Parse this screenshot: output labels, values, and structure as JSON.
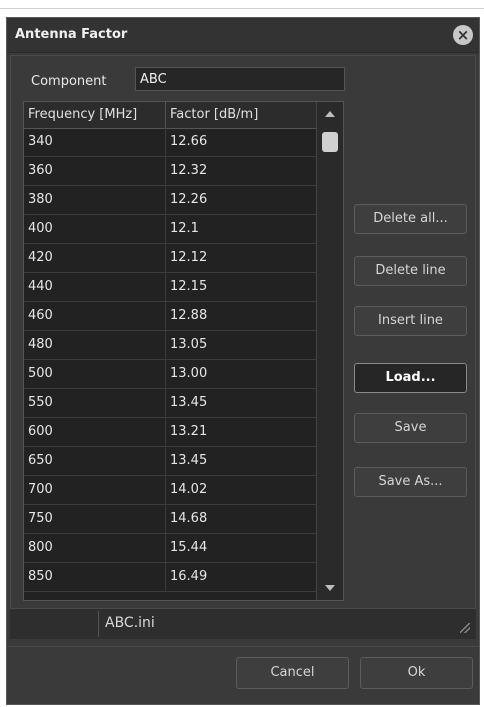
{
  "dialog": {
    "title": "Antenna Factor"
  },
  "component": {
    "label": "Component",
    "value": "ABC"
  },
  "table": {
    "headers": [
      "Frequency [MHz]",
      "Factor [dB/m]"
    ],
    "rows": [
      [
        "340",
        "12.66"
      ],
      [
        "360",
        "12.32"
      ],
      [
        "380",
        "12.26"
      ],
      [
        "400",
        "12.1"
      ],
      [
        "420",
        "12.12"
      ],
      [
        "440",
        "12.15"
      ],
      [
        "460",
        "12.88"
      ],
      [
        "480",
        "13.05"
      ],
      [
        "500",
        "13.00"
      ],
      [
        "550",
        "13.45"
      ],
      [
        "600",
        "13.21"
      ],
      [
        "650",
        "13.45"
      ],
      [
        "700",
        "14.02"
      ],
      [
        "750",
        "14.68"
      ],
      [
        "800",
        "15.44"
      ],
      [
        "850",
        "16.49"
      ]
    ]
  },
  "buttons": {
    "delete_all": "Delete all...",
    "delete_line": "Delete line",
    "insert_line": "Insert line",
    "load": "Load...",
    "save": "Save",
    "save_as": "Save As..."
  },
  "status": {
    "file": "ABC.ini"
  },
  "footer": {
    "cancel": "Cancel",
    "ok": "Ok"
  },
  "colors": {
    "dialog_bg": "#3a3a3a",
    "table_bg": "#222222",
    "text": "#e6e6e6"
  },
  "icons": {
    "close": "close-circle-icon",
    "resize": "resize-grip-icon"
  }
}
